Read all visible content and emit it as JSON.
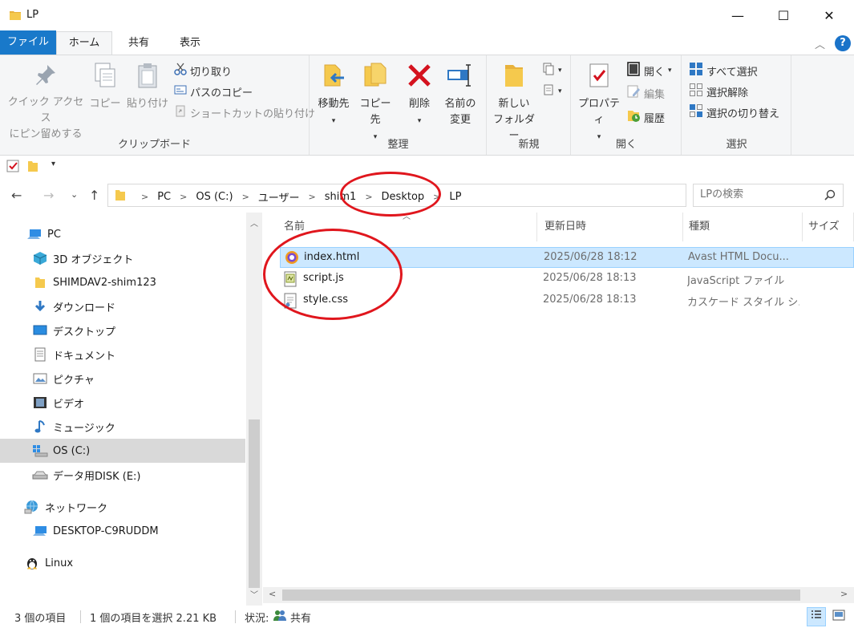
{
  "window": {
    "title": "LP",
    "controls": {
      "minimize": "—",
      "maximize": "☐",
      "close": "✕"
    }
  },
  "ribbon_tabs": {
    "file": "ファイル",
    "home": "ホーム",
    "share": "共有",
    "view": "表示"
  },
  "ribbon": {
    "clipboard": {
      "label": "クリップボード",
      "pin_quick_access": [
        "クイック アクセス",
        "にピン留めする"
      ],
      "copy": "コピー",
      "paste": "貼り付け",
      "cut": "切り取り",
      "copy_path": "パスのコピー",
      "paste_shortcut": "ショートカットの貼り付け"
    },
    "organize": {
      "label": "整理",
      "move_to": "移動先",
      "copy_to": "コピー先",
      "delete": "削除",
      "rename": [
        "名前の",
        "変更"
      ]
    },
    "new": {
      "label": "新規",
      "new_folder": [
        "新しい",
        "フォルダー"
      ]
    },
    "open": {
      "label": "開く",
      "properties": "プロパティ",
      "open": "開く",
      "edit": "編集",
      "history": "履歴"
    },
    "select": {
      "label": "選択",
      "select_all": "すべて選択",
      "select_none": "選択解除",
      "invert": "選択の切り替え"
    }
  },
  "address": {
    "crumbs": [
      "PC",
      "OS (C:)",
      "ユーザー",
      "shim1",
      "Desktop",
      "LP"
    ],
    "search_placeholder": "LPの検索"
  },
  "nav": {
    "items": [
      {
        "label": "PC",
        "icon": "pc-icon",
        "indent": 1
      },
      {
        "label": "3D オブジェクト",
        "icon": "3d-objects-icon",
        "indent": 2
      },
      {
        "label": "SHIMDAV2-shim123",
        "icon": "folder-icon",
        "indent": 2
      },
      {
        "label": "ダウンロード",
        "icon": "download-icon",
        "indent": 2
      },
      {
        "label": "デスクトップ",
        "icon": "desktop-icon",
        "indent": 2
      },
      {
        "label": "ドキュメント",
        "icon": "document-icon",
        "indent": 2
      },
      {
        "label": "ピクチャ",
        "icon": "pictures-icon",
        "indent": 2
      },
      {
        "label": "ビデオ",
        "icon": "video-icon",
        "indent": 2
      },
      {
        "label": "ミュージック",
        "icon": "music-icon",
        "indent": 2
      },
      {
        "label": "OS (C:)",
        "icon": "os-drive-icon",
        "indent": 2
      },
      {
        "label": "データ用DISK (E:)",
        "icon": "drive-icon",
        "indent": 2
      },
      {
        "label": "ネットワーク",
        "icon": "network-icon",
        "indent": 1
      },
      {
        "label": "DESKTOP-C9RUDDM",
        "icon": "computer-icon",
        "indent": 2
      },
      {
        "label": "Linux",
        "icon": "linux-icon",
        "indent": 1
      }
    ]
  },
  "columns": {
    "name": "名前",
    "modified": "更新日時",
    "type": "種類",
    "size": "サイズ"
  },
  "files": [
    {
      "name": "index.html",
      "modified": "2025/06/28 18:12",
      "type": "Avast HTML Docu...",
      "icon": "avast-html-icon"
    },
    {
      "name": "script.js",
      "modified": "2025/06/28 18:13",
      "type": "JavaScript ファイル",
      "icon": "js-file-icon"
    },
    {
      "name": "style.css",
      "modified": "2025/06/28 18:13",
      "type": "カスケード スタイル シ...",
      "icon": "css-file-icon"
    }
  ],
  "status": {
    "count": "3 個の項目",
    "selection": "1 個の項目を選択  2.21 KB",
    "state_label": "状況:",
    "state_value": "共有"
  },
  "colors": {
    "accent": "#1979ca",
    "selection_bg": "#cce8ff",
    "annotation": "#e0161d"
  }
}
